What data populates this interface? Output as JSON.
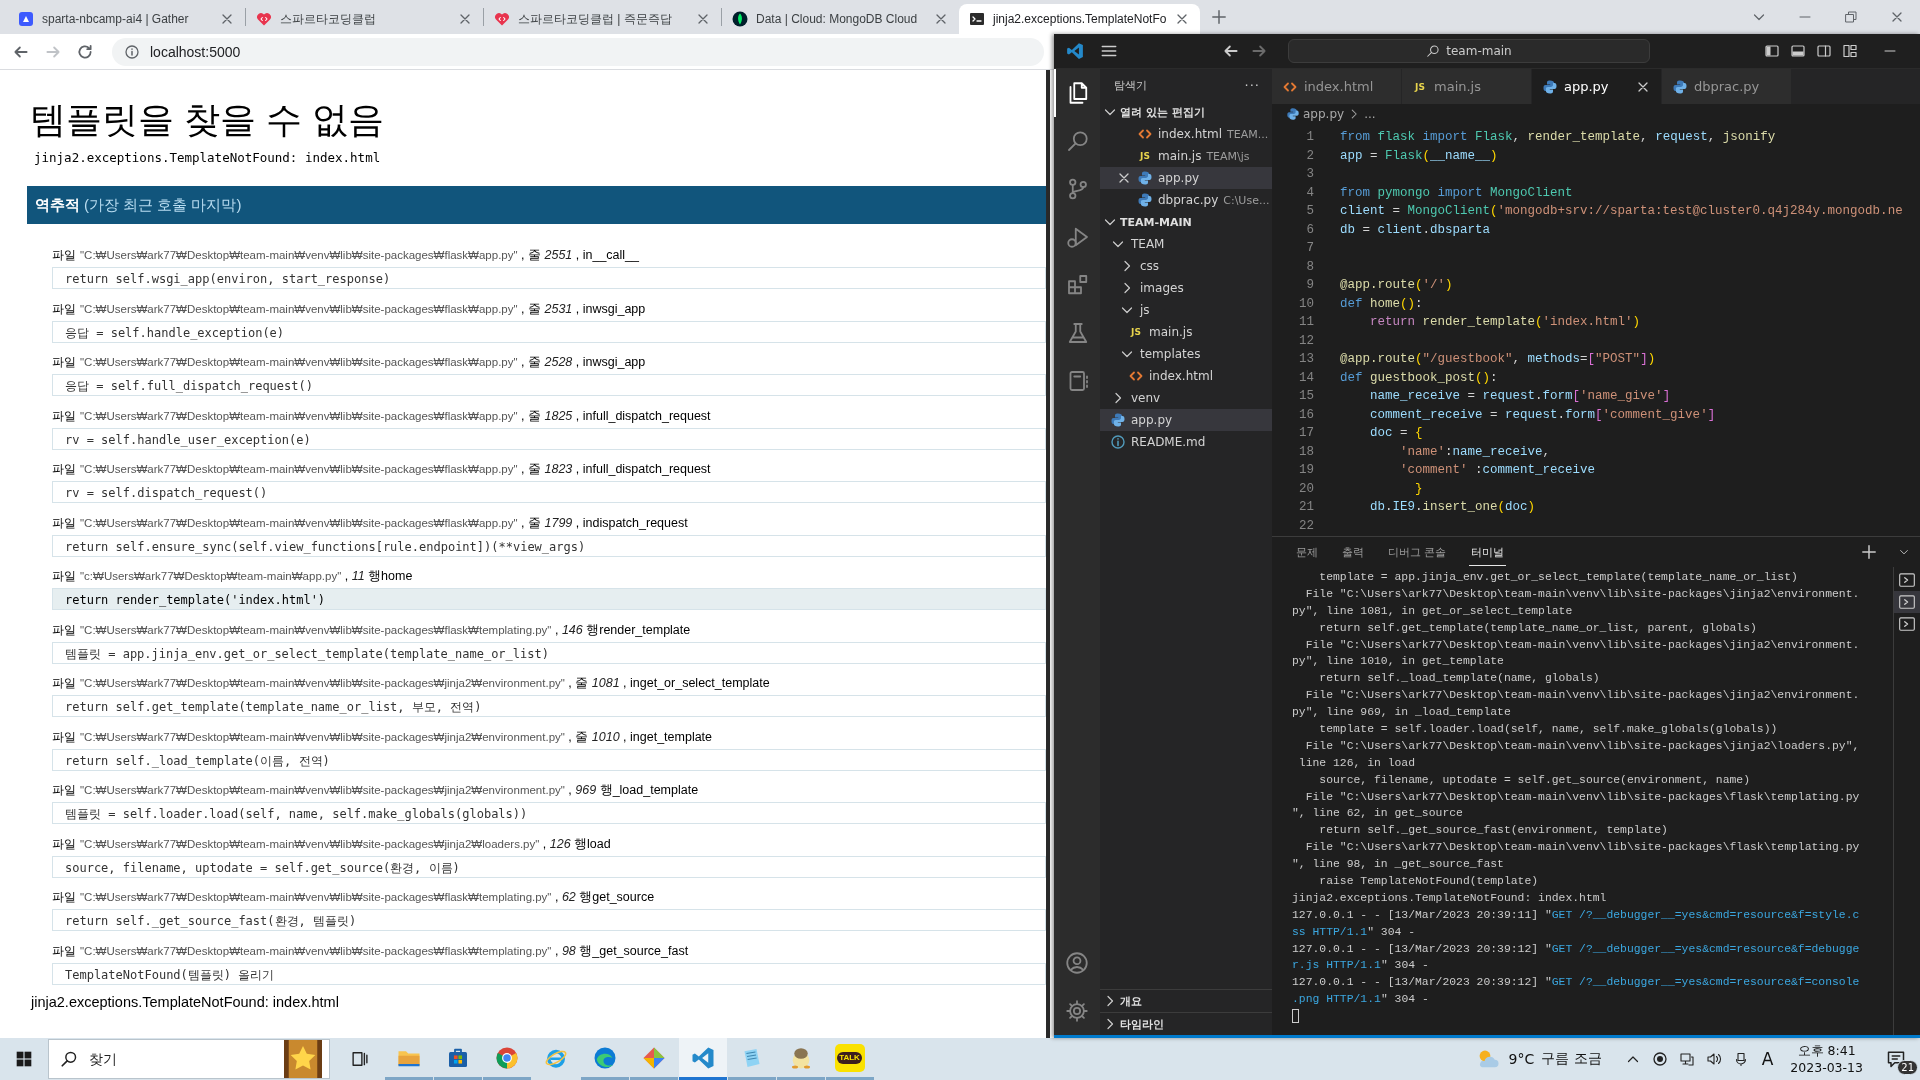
{
  "browser": {
    "tabs": [
      {
        "kind": "gather",
        "title": "sparta-nbcamp-ai4 | Gather",
        "selected": false
      },
      {
        "kind": "heart",
        "title": "스파르타코딩클럽",
        "selected": false
      },
      {
        "kind": "heart",
        "title": "스파르타코딩클럽 | 즉문즉답",
        "selected": false
      },
      {
        "kind": "leaf",
        "title": "Data | Cloud: MongoDB Cloud",
        "selected": false
      },
      {
        "kind": "terminal",
        "title": "jinja2.exceptions.TemplateNotFo",
        "selected": true
      }
    ],
    "address": "localhost:5000",
    "page": {
      "title": "템플릿을 찾을 수 없음",
      "subtitle": "jinja2.exceptions.TemplateNotFound: index.html",
      "traceback_heading": "역추적",
      "traceback_note": "(가장 최근 호출 마지막)",
      "frames": [
        {
          "label": "파일",
          "file": "\"C:₩Users₩ark77₩Desktop₩team-main₩venv₩lib₩site-packages₩flask₩app.py\"",
          "location": " , 줄 *2551* , in__call__",
          "code": "return self.wsgi_app(environ, start_response)",
          "current": false
        },
        {
          "label": "파일",
          "file": "\"C:₩Users₩ark77₩Desktop₩team-main₩venv₩lib₩site-packages₩flask₩app.py\"",
          "location": " , 줄 *2531* , inwsgi_app",
          "code": "응답 = self.handle_exception(e)",
          "current": false
        },
        {
          "label": "파일",
          "file": "\"C:₩Users₩ark77₩Desktop₩team-main₩venv₩lib₩site-packages₩flask₩app.py\"",
          "location": " , 줄 *2528* , inwsgi_app",
          "code": "응답 = self.full_dispatch_request()",
          "current": false
        },
        {
          "label": "파일",
          "file": "\"C:₩Users₩ark77₩Desktop₩team-main₩venv₩lib₩site-packages₩flask₩app.py\"",
          "location": " , 줄 *1825* , infull_dispatch_request",
          "code": "rv = self.handle_user_exception(e)",
          "current": false
        },
        {
          "label": "파일",
          "file": "\"C:₩Users₩ark77₩Desktop₩team-main₩venv₩lib₩site-packages₩flask₩app.py\"",
          "location": " , 줄 *1823* , infull_dispatch_request",
          "code": "rv = self.dispatch_request()",
          "current": false
        },
        {
          "label": "파일",
          "file": "\"C:₩Users₩ark77₩Desktop₩team-main₩venv₩lib₩site-packages₩flask₩app.py\"",
          "location": " , 줄 *1799* , indispatch_request",
          "code": "return self.ensure_sync(self.view_functions[rule.endpoint])(**view_args)",
          "current": false
        },
        {
          "label": "파일",
          "file": "\"c:₩Users₩ark77₩Desktop₩team-main₩app.py\"",
          "location": " , *11* 행home",
          "code": "return render_template('index.html')",
          "current": true
        },
        {
          "label": "파일",
          "file": "\"C:₩Users₩ark77₩Desktop₩team-main₩venv₩lib₩site-packages₩flask₩templating.py\"",
          "location": " , *146* 행render_template",
          "code": "템플릿 = app.jinja_env.get_or_select_template(template_name_or_list)",
          "current": false
        },
        {
          "label": "파일",
          "file": "\"C:₩Users₩ark77₩Desktop₩team-main₩venv₩lib₩site-packages₩jinja2₩environment.py\"",
          "location": " , 줄 *1081* , inget_or_select_template",
          "code": "return self.get_template(template_name_or_list, 부모, 전역)",
          "current": false
        },
        {
          "label": "파일",
          "file": "\"C:₩Users₩ark77₩Desktop₩team-main₩venv₩lib₩site-packages₩jinja2₩environment.py\"",
          "location": " , 줄 *1010* , inget_template",
          "code": "return self._load_template(이름, 전역)",
          "current": false
        },
        {
          "label": "파일",
          "file": "\"C:₩Users₩ark77₩Desktop₩team-main₩venv₩lib₩site-packages₩jinja2₩environment.py\"",
          "location": " , *969* 행_load_template",
          "code": "템플릿 = self.loader.load(self, name, self.make_globals(globals))",
          "current": false
        },
        {
          "label": "파일",
          "file": "\"C:₩Users₩ark77₩Desktop₩team-main₩venv₩lib₩site-packages₩jinja2₩loaders.py\"",
          "location": " , *126* 행load",
          "code": "source, filename, uptodate = self.get_source(환경, 이름)",
          "current": false
        },
        {
          "label": "파일",
          "file": "\"C:₩Users₩ark77₩Desktop₩team-main₩venv₩lib₩site-packages₩flask₩templating.py\"",
          "location": " , *62* 행get_source",
          "code": "return self._get_source_fast(환경, 템플릿)",
          "current": false
        },
        {
          "label": "파일",
          "file": "\"C:₩Users₩ark77₩Desktop₩team-main₩venv₩lib₩site-packages₩flask₩templating.py\"",
          "location": " , *98* 행_get_source_fast",
          "code": "TemplateNotFound(템플릿) 올리기",
          "current": false
        }
      ],
      "footer": "jinja2.exceptions.TemplateNotFound: index.html"
    }
  },
  "vscode": {
    "command_center": "team-main",
    "activity": [
      {
        "kind": "files",
        "selected": true
      },
      {
        "kind": "search",
        "selected": false
      },
      {
        "kind": "branch",
        "selected": false
      },
      {
        "kind": "run",
        "selected": false
      },
      {
        "kind": "extensions",
        "selected": false
      },
      {
        "kind": "flask",
        "selected": false
      },
      {
        "kind": "notebook",
        "selected": false
      }
    ],
    "sidebar": {
      "title": "탐색기",
      "more": "···",
      "open_editors": {
        "label": "열려 있는 편집기",
        "expanded": true,
        "items": [
          {
            "label": "index.html",
            "detail": "TEAM...",
            "kind": "html",
            "selected": false
          },
          {
            "label": "main.js",
            "detail": "TEAM\\js",
            "kind": "js",
            "icon_text": "JS",
            "selected": false
          },
          {
            "label": "app.py",
            "kind": "py",
            "selected": true
          },
          {
            "label": "dbprac.py",
            "detail": "C:\\Use...",
            "kind": "py",
            "selected": false
          }
        ]
      },
      "workspace": {
        "label": "TEAM-MAIN",
        "expanded": true,
        "children": [
          {
            "label": "TEAM",
            "kind": "folder",
            "expanded": true,
            "selected": false,
            "children": [
              {
                "label": "css",
                "kind": "folder",
                "expanded": false,
                "selected": false
              },
              {
                "label": "images",
                "kind": "folder",
                "expanded": false,
                "selected": false
              },
              {
                "label": "js",
                "kind": "folder",
                "expanded": true,
                "selected": false,
                "children": [
                  {
                    "label": "main.js",
                    "kind": "js",
                    "icon_text": "JS",
                    "selected": false
                  }
                ]
              },
              {
                "label": "templates",
                "kind": "folder",
                "expanded": true,
                "selected": false,
                "children": [
                  {
                    "label": "index.html",
                    "kind": "html",
                    "selected": false
                  }
                ]
              }
            ]
          },
          {
            "label": "venv",
            "kind": "folder",
            "expanded": false,
            "selected": false
          },
          {
            "label": "app.py",
            "kind": "py",
            "selected": true
          },
          {
            "label": "README.md",
            "kind": "info",
            "selected": false
          }
        ]
      },
      "bottom_sections": [
        {
          "label": "개요",
          "expanded": false
        },
        {
          "label": "타임라인",
          "expanded": false
        }
      ]
    },
    "editor_tabs": [
      {
        "label": "index.html",
        "kind": "html",
        "selected": false
      },
      {
        "label": "main.js",
        "kind": "js",
        "icon_text": "JS",
        "selected": false
      },
      {
        "label": "app.py",
        "kind": "py",
        "selected": true
      },
      {
        "label": "dbprac.py",
        "kind": "py",
        "selected": false
      }
    ],
    "breadcrumb": {
      "file": "app.py",
      "kind": "py",
      "rest": "..."
    },
    "code": [
      {
        "number": "1",
        "tokens": [
          {
            "kind": "kw",
            "text": "from "
          },
          {
            "kind": "cls",
            "text": "flask "
          },
          {
            "kind": "kw",
            "text": "import "
          },
          {
            "kind": "cls",
            "text": "Flask"
          },
          {
            "kind": "op",
            "text": ", "
          },
          {
            "kind": "fn",
            "text": "render_template"
          },
          {
            "kind": "op",
            "text": ", "
          },
          {
            "kind": "var",
            "text": "request"
          },
          {
            "kind": "op",
            "text": ", "
          },
          {
            "kind": "fn",
            "text": "jsonify"
          }
        ]
      },
      {
        "number": "2",
        "tokens": [
          {
            "kind": "var",
            "text": "app"
          },
          {
            "kind": "op",
            "text": " = "
          },
          {
            "kind": "cls",
            "text": "Flask"
          },
          {
            "kind": "br",
            "text": "("
          },
          {
            "kind": "var",
            "text": "__name__"
          },
          {
            "kind": "br",
            "text": ")"
          }
        ]
      },
      {
        "number": "3"
      },
      {
        "number": "4",
        "tokens": [
          {
            "kind": "kw",
            "text": "from "
          },
          {
            "kind": "cls",
            "text": "pymongo "
          },
          {
            "kind": "kw",
            "text": "import "
          },
          {
            "kind": "cls",
            "text": "MongoClient"
          }
        ]
      },
      {
        "number": "5",
        "tokens": [
          {
            "kind": "var",
            "text": "client"
          },
          {
            "kind": "op",
            "text": " = "
          },
          {
            "kind": "cls",
            "text": "MongoClient"
          },
          {
            "kind": "br",
            "text": "("
          },
          {
            "kind": "str",
            "text": "'mongodb+srv://sparta:test@cluster0.q4j284y.mongodb.ne"
          }
        ]
      },
      {
        "number": "6",
        "tokens": [
          {
            "kind": "var",
            "text": "db"
          },
          {
            "kind": "op",
            "text": " = "
          },
          {
            "kind": "var",
            "text": "client"
          },
          {
            "kind": "op",
            "text": "."
          },
          {
            "kind": "var",
            "text": "dbsparta"
          }
        ]
      },
      {
        "number": "7"
      },
      {
        "number": "8"
      },
      {
        "number": "9",
        "tokens": [
          {
            "kind": "fn",
            "text": "@app.route"
          },
          {
            "kind": "br",
            "text": "("
          },
          {
            "kind": "str",
            "text": "'/'"
          },
          {
            "kind": "br",
            "text": ")"
          }
        ]
      },
      {
        "number": "10",
        "tokens": [
          {
            "kind": "kw",
            "text": "def "
          },
          {
            "kind": "fn",
            "text": "home"
          },
          {
            "kind": "br",
            "text": "()"
          },
          {
            "kind": "op",
            "text": ":"
          }
        ]
      },
      {
        "number": "11",
        "tokens": [
          {
            "kind": "ctl",
            "text": "    return "
          },
          {
            "kind": "fn",
            "text": "render_template"
          },
          {
            "kind": "br",
            "text": "("
          },
          {
            "kind": "str",
            "text": "'index.html'"
          },
          {
            "kind": "br",
            "text": ")"
          }
        ]
      },
      {
        "number": "12"
      },
      {
        "number": "13",
        "tokens": [
          {
            "kind": "fn",
            "text": "@app.route"
          },
          {
            "kind": "br",
            "text": "("
          },
          {
            "kind": "str",
            "text": "\"/guestbook\""
          },
          {
            "kind": "op",
            "text": ", "
          },
          {
            "kind": "var",
            "text": "methods"
          },
          {
            "kind": "op",
            "text": "="
          },
          {
            "kind": "br2",
            "text": "["
          },
          {
            "kind": "str",
            "text": "\"POST\""
          },
          {
            "kind": "br2",
            "text": "]"
          },
          {
            "kind": "br",
            "text": ")"
          }
        ]
      },
      {
        "number": "14",
        "tokens": [
          {
            "kind": "kw",
            "text": "def "
          },
          {
            "kind": "fn",
            "text": "guestbook_post"
          },
          {
            "kind": "br",
            "text": "()"
          },
          {
            "kind": "op",
            "text": ":"
          }
        ]
      },
      {
        "number": "15",
        "tokens": [
          {
            "kind": "var",
            "text": "    name_receive"
          },
          {
            "kind": "op",
            "text": " = "
          },
          {
            "kind": "var",
            "text": "request"
          },
          {
            "kind": "op",
            "text": "."
          },
          {
            "kind": "var",
            "text": "form"
          },
          {
            "kind": "br2",
            "text": "["
          },
          {
            "kind": "str",
            "text": "'name_give'"
          },
          {
            "kind": "br2",
            "text": "]"
          }
        ]
      },
      {
        "number": "16",
        "tokens": [
          {
            "kind": "var",
            "text": "    comment_receive"
          },
          {
            "kind": "op",
            "text": " = "
          },
          {
            "kind": "var",
            "text": "request"
          },
          {
            "kind": "op",
            "text": "."
          },
          {
            "kind": "var",
            "text": "form"
          },
          {
            "kind": "br2",
            "text": "["
          },
          {
            "kind": "str",
            "text": "'comment_give'"
          },
          {
            "kind": "br2",
            "text": "]"
          }
        ]
      },
      {
        "number": "17",
        "tokens": [
          {
            "kind": "var",
            "text": "    doc"
          },
          {
            "kind": "op",
            "text": " = "
          },
          {
            "kind": "br",
            "text": "{"
          }
        ]
      },
      {
        "number": "18",
        "tokens": [
          {
            "kind": "str",
            "text": "        'name'"
          },
          {
            "kind": "op",
            "text": ":"
          },
          {
            "kind": "var",
            "text": "name_receive"
          },
          {
            "kind": "op",
            "text": ","
          }
        ]
      },
      {
        "number": "19",
        "tokens": [
          {
            "kind": "str",
            "text": "        'comment'"
          },
          {
            "kind": "op",
            "text": " :"
          },
          {
            "kind": "var",
            "text": "comment_receive"
          }
        ]
      },
      {
        "number": "20",
        "tokens": [
          {
            "kind": "br",
            "text": "          }"
          }
        ]
      },
      {
        "number": "21",
        "tokens": [
          {
            "kind": "var",
            "text": "    db"
          },
          {
            "kind": "op",
            "text": "."
          },
          {
            "kind": "var",
            "text": "IE9"
          },
          {
            "kind": "op",
            "text": "."
          },
          {
            "kind": "fn",
            "text": "insert_one"
          },
          {
            "kind": "br",
            "text": "("
          },
          {
            "kind": "var",
            "text": "doc"
          },
          {
            "kind": "br",
            "text": ")"
          }
        ]
      },
      {
        "number": "22"
      }
    ],
    "panel_tabs": [
      {
        "label": "문제",
        "selected": false
      },
      {
        "label": "출력",
        "selected": false
      },
      {
        "label": "디버그 콘솔",
        "selected": false
      },
      {
        "label": "터미널",
        "selected": true
      }
    ],
    "terminal": [
      [
        {
          "kind": "plain",
          "text": "    template = app.jinja_env.get_or_select_template(template_name_or_list)"
        }
      ],
      [
        {
          "kind": "plain",
          "text": "  File \"C:\\Users\\ark77\\Desktop\\team-main\\venv\\lib\\site-packages\\jinja2\\environment."
        }
      ],
      [
        {
          "kind": "plain",
          "text": "py\", line 1081, in get_or_select_template"
        }
      ],
      [
        {
          "kind": "plain",
          "text": "    return self.get_template(template_name_or_list, parent, globals)"
        }
      ],
      [
        {
          "kind": "plain",
          "text": "  File \"C:\\Users\\ark77\\Desktop\\team-main\\venv\\lib\\site-packages\\jinja2\\environment."
        }
      ],
      [
        {
          "kind": "plain",
          "text": "py\", line 1010, in get_template"
        }
      ],
      [
        {
          "kind": "plain",
          "text": "    return self._load_template(name, globals)"
        }
      ],
      [
        {
          "kind": "plain",
          "text": "  File \"C:\\Users\\ark77\\Desktop\\team-main\\venv\\lib\\site-packages\\jinja2\\environment."
        }
      ],
      [
        {
          "kind": "plain",
          "text": "py\", line 969, in _load_template"
        }
      ],
      [
        {
          "kind": "plain",
          "text": "    template = self.loader.load(self, name, self.make_globals(globals))"
        }
      ],
      [
        {
          "kind": "plain",
          "text": "  File \"C:\\Users\\ark77\\Desktop\\team-main\\venv\\lib\\site-packages\\jinja2\\loaders.py\","
        }
      ],
      [
        {
          "kind": "plain",
          "text": " line 126, in load"
        }
      ],
      [
        {
          "kind": "plain",
          "text": "    source, filename, uptodate = self.get_source(environment, name)"
        }
      ],
      [
        {
          "kind": "plain",
          "text": "  File \"C:\\Users\\ark77\\Desktop\\team-main\\venv\\lib\\site-packages\\flask\\templating.py"
        }
      ],
      [
        {
          "kind": "plain",
          "text": "\", line 62, in get_source"
        }
      ],
      [
        {
          "kind": "plain",
          "text": "    return self._get_source_fast(environment, template)"
        }
      ],
      [
        {
          "kind": "plain",
          "text": "  File \"C:\\Users\\ark77\\Desktop\\team-main\\venv\\lib\\site-packages\\flask\\templating.py"
        }
      ],
      [
        {
          "kind": "plain",
          "text": "\", line 98, in _get_source_fast"
        }
      ],
      [
        {
          "kind": "plain",
          "text": "    raise TemplateNotFound(template)"
        }
      ],
      [
        {
          "kind": "plain",
          "text": "jinja2.exceptions.TemplateNotFound: index.html"
        }
      ],
      [
        {
          "kind": "plain",
          "text": "127.0.0.1 - - [13/Mar/2023 20:39:11] \""
        },
        {
          "kind": "link",
          "text": "GET /?__debugger__=yes&cmd=resource&f=style.c"
        }
      ],
      [
        {
          "kind": "link",
          "text": "ss HTTP/1.1"
        },
        {
          "kind": "plain",
          "text": "\" 304 -"
        }
      ],
      [
        {
          "kind": "plain",
          "text": "127.0.0.1 - - [13/Mar/2023 20:39:12] \""
        },
        {
          "kind": "link",
          "text": "GET /?__debugger__=yes&cmd=resource&f=debugge"
        }
      ],
      [
        {
          "kind": "link",
          "text": "r.js HTTP/1.1"
        },
        {
          "kind": "plain",
          "text": "\" 304 -"
        }
      ],
      [
        {
          "kind": "plain",
          "text": "127.0.0.1 - - [13/Mar/2023 20:39:12] \""
        },
        {
          "kind": "link",
          "text": "GET /?__debugger__=yes&cmd=resource&f=console"
        }
      ],
      [
        {
          "kind": "link",
          "text": ".png HTTP/1.1"
        },
        {
          "kind": "plain",
          "text": "\" 304 -"
        }
      ]
    ],
    "terminal_sessions": [
      {
        "selected": false
      },
      {
        "selected": true
      },
      {
        "selected": false
      }
    ]
  },
  "taskbar": {
    "search": {
      "placeholder": "찾기"
    },
    "apps": [
      {
        "kind": "folder",
        "running": true,
        "selected": false
      },
      {
        "kind": "store",
        "running": true,
        "selected": false
      },
      {
        "kind": "chrome",
        "running": true,
        "selected": false
      },
      {
        "kind": "ie",
        "running": false,
        "selected": false
      },
      {
        "kind": "edge",
        "running": true,
        "selected": false
      },
      {
        "kind": "diamond",
        "running": true,
        "selected": false
      },
      {
        "kind": "code",
        "running": true,
        "selected": true
      },
      {
        "kind": "notepad",
        "running": true,
        "selected": false
      },
      {
        "kind": "mascot",
        "running": true,
        "selected": false
      },
      {
        "kind": "chat",
        "label": "TALK",
        "running": true,
        "selected": false
      }
    ],
    "weather": {
      "temperature": "9°C",
      "condition": "구름 조금"
    },
    "ime": "A",
    "time": "오후 8:41",
    "date": "2023-03-13",
    "notifications": "21"
  }
}
